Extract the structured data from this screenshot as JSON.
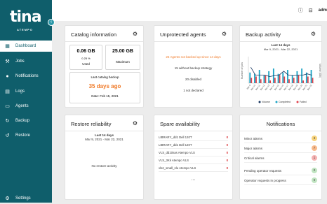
{
  "app": {
    "logo_text": "tina",
    "logo_sub": "ATEMPO",
    "user": "adm"
  },
  "sidebar": {
    "items": [
      {
        "label": "Dashboard",
        "icon": "grid-icon"
      },
      {
        "label": "Jobs",
        "icon": "wrench-icon"
      },
      {
        "label": "Notifications",
        "icon": "bell-icon"
      },
      {
        "label": "Logs",
        "icon": "document-icon"
      },
      {
        "label": "Agents",
        "icon": "monitor-icon"
      },
      {
        "label": "Backup",
        "icon": "backup-icon"
      },
      {
        "label": "Restore",
        "icon": "restore-icon"
      }
    ],
    "settings": "Settings"
  },
  "catalog": {
    "title": "Catalog information",
    "used_value": "0.06 GB",
    "used_pct": "0.25 %",
    "used_label": "Used",
    "max_value": "25.00 GB",
    "max_label": "Maximum",
    "last_backup_label": "Last catalog backup",
    "days_ago": "35 days ago",
    "date": "Date: Feb 15, 2021"
  },
  "unprotected": {
    "title": "Unprotected agents",
    "warning": "26 Agents not backed up since 14 days",
    "lines": [
      "15 without backup strategy",
      "20 disabled",
      "1 not declared"
    ]
  },
  "backup": {
    "title": "Backup activity",
    "period": "Last 14 days",
    "range": "Mar 9, 2021 - Mar 22, 2021",
    "ylabel_left": "Number of jobs",
    "ylabel_right": "Volume (GB)",
    "legend": [
      "Volume",
      "Completed",
      "Failed"
    ]
  },
  "chart_data": {
    "type": "bar",
    "categories": [
      "Mar 9",
      "Mar 10",
      "Mar 11",
      "Mar 12",
      "Mar 13",
      "Mar 14",
      "Mar 15",
      "Mar 16",
      "Mar 17",
      "Mar 18",
      "Mar 19",
      "Mar 20",
      "Mar 21",
      "Mar 22"
    ],
    "series": [
      {
        "name": "Completed",
        "values": [
          40,
          35,
          50,
          30,
          45,
          55,
          35,
          40,
          50,
          30,
          45,
          55,
          40,
          50
        ]
      },
      {
        "name": "Failed",
        "values": [
          20,
          25,
          15,
          30,
          10,
          20,
          30,
          25,
          15,
          20,
          30,
          10,
          25,
          20
        ]
      },
      {
        "name": "Volume",
        "values": [
          60,
          30,
          30,
          30,
          25,
          28,
          30,
          45,
          30,
          28,
          30,
          30,
          35,
          30
        ]
      }
    ],
    "colors": {
      "Completed": "#1aa3c4",
      "Failed": "#e0414b",
      "Volume": "#15335e"
    }
  },
  "restore": {
    "title": "Restore reliability",
    "period": "Last 14 days",
    "range": "Mar 9, 2021 - Mar 22, 2021",
    "empty": "No restore activity"
  },
  "spare": {
    "title": "Spare availability",
    "rows": [
      {
        "name": "LIBRARY_dd1 Dell 120T",
        "count": "0"
      },
      {
        "name": "LIBRARY_dd1 Dell 120T",
        "count": "0"
      },
      {
        "name": "VLS_dd1tinas Atempo VLS",
        "count": "0"
      },
      {
        "name": "VLS_3Kk Atempo VLS",
        "count": "0"
      },
      {
        "name": "vls2_small_nlu Atempo VLS",
        "count": "0"
      }
    ],
    "more": "..."
  },
  "notifications": {
    "title": "Notifications",
    "rows": [
      {
        "label": "Minor alarms",
        "count": "3",
        "color": "#f7d27a"
      },
      {
        "label": "Major alarms",
        "count": "7",
        "color": "#f9b98a"
      },
      {
        "label": "Critical alarms",
        "count": "1",
        "color": "#f6b1b1"
      },
      {
        "label": "Pending operator requests",
        "count": "0",
        "color": "#bfe3c0"
      },
      {
        "label": "Operator requests in progress",
        "count": "0",
        "color": "#bfe3c0"
      }
    ]
  }
}
